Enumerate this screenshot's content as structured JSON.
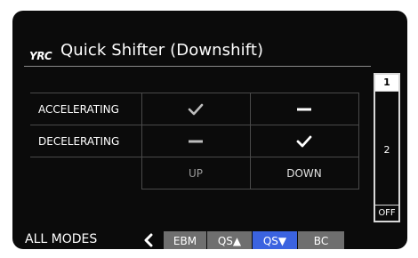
{
  "header": {
    "logo_text": "YRC",
    "title": "Quick Shifter (Downshift)"
  },
  "grid": {
    "row_labels": [
      "ACCELERATING",
      "DECELERATING"
    ],
    "col_labels": [
      "UP",
      "DOWN"
    ],
    "active_column": "DOWN",
    "cells": [
      [
        "check",
        "dash"
      ],
      [
        "dash",
        "check"
      ]
    ]
  },
  "level_selector": {
    "levels": [
      "1",
      "2",
      "OFF"
    ],
    "selected": "1"
  },
  "footer": {
    "modes_label": "ALL MODES",
    "tabs": [
      "EBM",
      "QS▲",
      "QS▼",
      "BC"
    ],
    "active_tab": "QS▼"
  },
  "colors": {
    "accent": "#3b63e0",
    "tab_inactive": "#6f6f6f",
    "background": "#0b0b0b"
  }
}
